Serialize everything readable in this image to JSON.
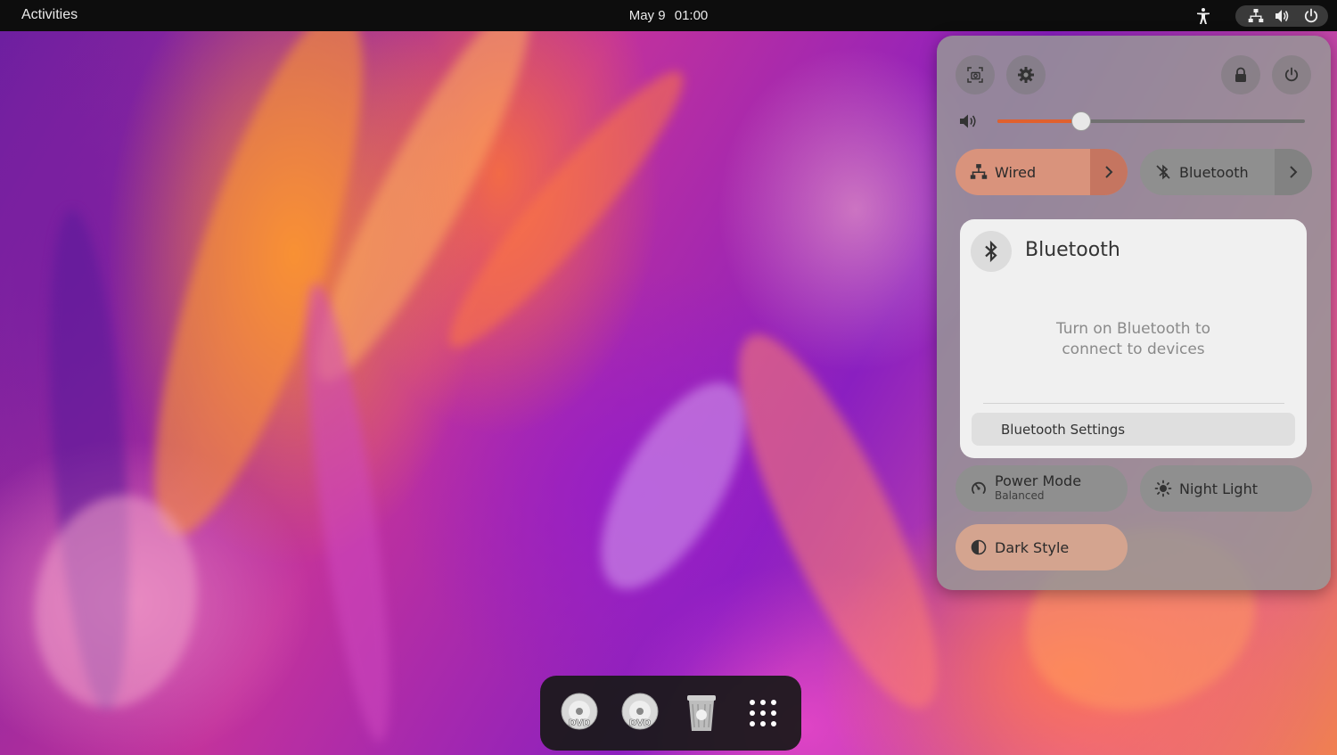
{
  "topbar": {
    "activities_label": "Activities",
    "date": "May 9",
    "time": "01:00"
  },
  "quick_settings": {
    "volume_level_percent": 27,
    "wired": {
      "label": "Wired",
      "active": true
    },
    "bluetooth_toggle": {
      "label": "Bluetooth",
      "active": false
    },
    "bluetooth_menu": {
      "title": "Bluetooth",
      "message_line1": "Turn on Bluetooth to",
      "message_line2": "connect to devices",
      "settings_label": "Bluetooth Settings"
    },
    "power_mode": {
      "label": "Power Mode",
      "sublabel": "Balanced"
    },
    "night_light": {
      "label": "Night Light"
    },
    "dark_style": {
      "label": "Dark Style",
      "active": true
    }
  },
  "dock": {
    "items": [
      "dvd-drive",
      "dvd-drive",
      "trash",
      "show-apps"
    ]
  },
  "colors": {
    "accent": "#e0602e",
    "active_toggle": "#d9937c",
    "panel_bg": "#969696"
  }
}
